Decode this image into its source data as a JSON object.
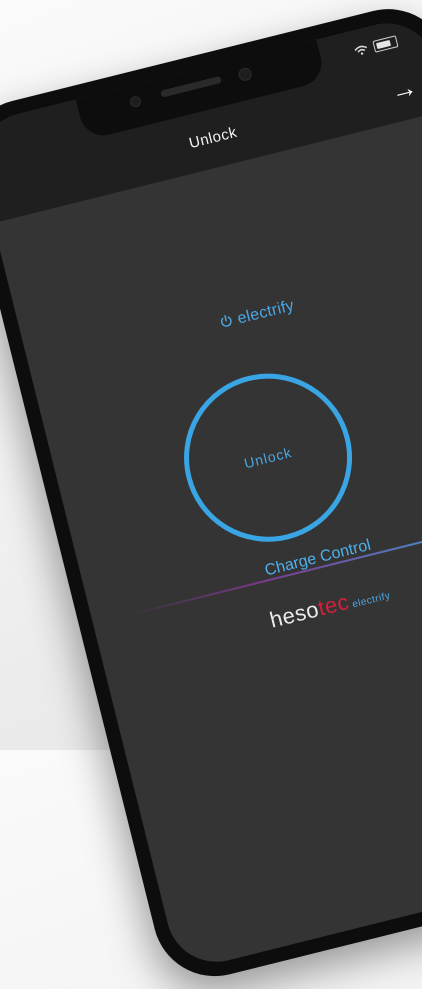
{
  "nav": {
    "title": "Unlock",
    "forward_icon": "arrow-right-icon",
    "forward_glyph": "→"
  },
  "status_bar": {
    "wifi_icon": "wifi-icon",
    "battery_icon": "battery-icon"
  },
  "brand": {
    "icon": "power-icon",
    "label": "electrify"
  },
  "unlock_button": {
    "label": "Unlock"
  },
  "charge_control": {
    "label": "Charge Control"
  },
  "footer_logo": {
    "part1": "heso",
    "part2": "tec",
    "part3": "electrify"
  },
  "colors": {
    "accent": "#3aa5e4",
    "brand_red": "#d2213a",
    "background": "#343434",
    "navbar": "#1f1f1f"
  }
}
